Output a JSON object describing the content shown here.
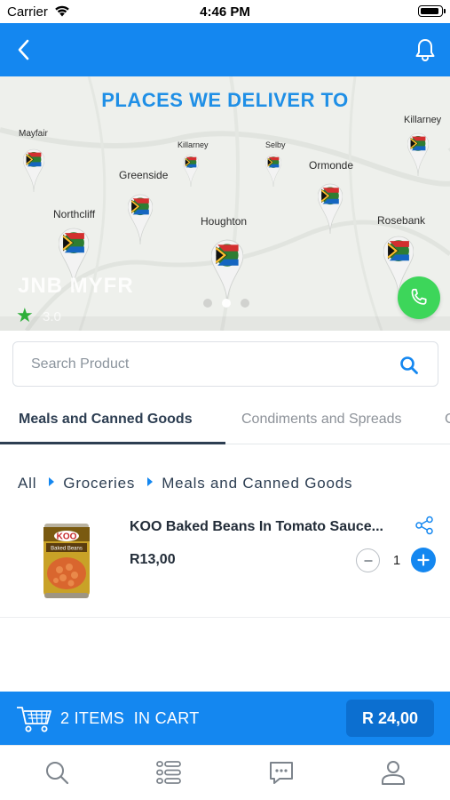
{
  "status_bar": {
    "carrier": "Carrier",
    "time": "4:46 PM"
  },
  "header": {
    "back_icon": "chevron-left-icon",
    "bell_icon": "bell-icon",
    "color": "#1487f0"
  },
  "banner": {
    "headline": "PLACES WE DELIVER TO",
    "places": [
      "Mayfair",
      "Killarney",
      "Selby",
      "Killarney",
      "Greenside",
      "Ormonde",
      "Northcliff",
      "Houghton",
      "Rosebank"
    ],
    "store_name": "JNB MYFR",
    "rating": "3.0",
    "slide_count": 3,
    "active_slide": 2,
    "call_icon": "phone-icon",
    "call_color": "#3dd65a"
  },
  "search": {
    "placeholder": "Search Product",
    "value": ""
  },
  "tabs": [
    {
      "label": "Meals and Canned Goods",
      "active": true
    },
    {
      "label": "Condiments and Spreads",
      "active": false
    },
    {
      "label": "C",
      "active": false
    }
  ],
  "breadcrumb": [
    "All",
    "Groceries",
    "Meals and Canned Goods"
  ],
  "product": {
    "name": "KOO Baked Beans In Tomato Sauce...",
    "price": "R13,00",
    "quantity": "1",
    "brand": "KOO",
    "can_text": "Baked Beans"
  },
  "cart": {
    "label": "2 ITEMS  IN CART",
    "total": "R 24,00"
  },
  "bottom_nav": [
    {
      "icon": "search-icon"
    },
    {
      "icon": "list-icon"
    },
    {
      "icon": "chat-icon"
    },
    {
      "icon": "profile-icon"
    }
  ]
}
